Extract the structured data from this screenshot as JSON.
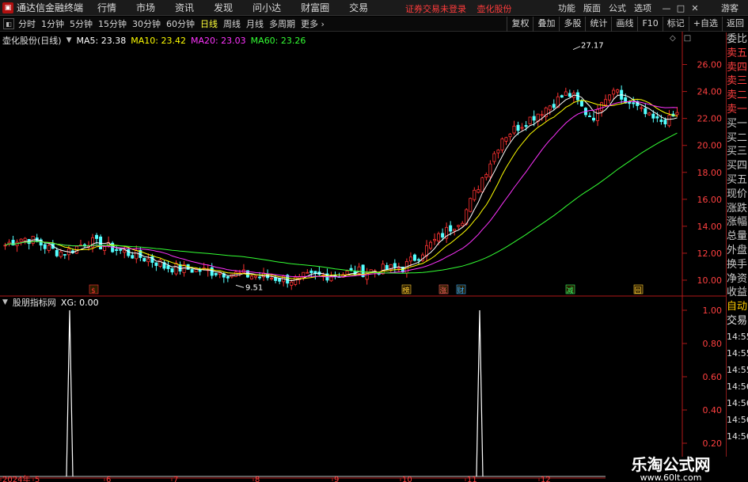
{
  "app": {
    "title": "通达信金融终端",
    "icon": "app-logo-icon"
  },
  "menu": [
    "行情",
    "市场",
    "资讯",
    "发现",
    "问小达",
    "财富圈",
    "交易"
  ],
  "notice": {
    "left": "证券交易未登录",
    "right": "壶化股份"
  },
  "menu_right": [
    "功能",
    "版面",
    "公式",
    "选项"
  ],
  "guest": "游客",
  "periods": [
    {
      "label": "分时",
      "active": false
    },
    {
      "label": "1分钟",
      "active": false
    },
    {
      "label": "5分钟",
      "active": false
    },
    {
      "label": "15分钟",
      "active": false
    },
    {
      "label": "30分钟",
      "active": false
    },
    {
      "label": "60分钟",
      "active": false
    },
    {
      "label": "日线",
      "active": true
    },
    {
      "label": "周线",
      "active": false
    },
    {
      "label": "月线",
      "active": false
    },
    {
      "label": "多周期",
      "active": false
    },
    {
      "label": "更多",
      "active": false
    }
  ],
  "toolbar_right": [
    "复权",
    "叠加",
    "多股",
    "统计",
    "画线",
    "F10",
    "标记",
    "+自选",
    "返回"
  ],
  "stock": {
    "name": "壶化股份(日线)",
    "ma5": "MA5: 23.38",
    "ma10": "MA10: 23.42",
    "ma20": "MA20: 23.03",
    "ma60": "MA60: 23.26"
  },
  "indicator": {
    "name": "股朋指标网",
    "value": "XG: 0.00"
  },
  "colors": {
    "up": "#ff3232",
    "down": "#54ffff",
    "ma5": "#ffffff",
    "ma10": "#ffff00",
    "ma20": "#ff33ff",
    "ma60": "#33ff33",
    "axis": "#b01818"
  },
  "price_axis": [
    "26.00",
    "24.00",
    "22.00",
    "20.00",
    "18.00",
    "16.00",
    "14.00",
    "12.00",
    "10.00"
  ],
  "price_labels": {
    "high": "27.17",
    "low": "9.51"
  },
  "ind_axis": [
    "1.00",
    "0.80",
    "0.60",
    "0.40",
    "0.20"
  ],
  "date_axis": [
    "2024年",
    "5",
    "6",
    "7",
    "8",
    "9",
    "10",
    "11",
    "12"
  ],
  "event_markers": [
    {
      "label": "$",
      "color": "#ff3232"
    },
    {
      "label": "榜",
      "color": "#ffcc33"
    },
    {
      "label": "涨",
      "color": "#ff6060"
    },
    {
      "label": "财",
      "color": "#33aaff"
    },
    {
      "label": "减",
      "color": "#33ff66"
    },
    {
      "label": "回",
      "color": "#ffcc33"
    }
  ],
  "side_panel": {
    "items": [
      "委比",
      "卖五",
      "卖四",
      "卖三",
      "卖二",
      "卖一",
      "买一",
      "买二",
      "买三",
      "买四",
      "买五",
      "现价",
      "涨跌",
      "涨幅",
      "总量",
      "外盘",
      "换手",
      "净资",
      "收益"
    ],
    "auto": "自动",
    "deal": "交易",
    "times": [
      "14:55",
      "14:55",
      "14:55",
      "14:56",
      "14:56",
      "14:56",
      "14:56"
    ]
  },
  "watermark": {
    "title": "乐淘公式网",
    "url": "www.60lt.com"
  },
  "chart_data": {
    "type": "candlestick",
    "title": "壶化股份(日线)",
    "ylim": [
      9.0,
      27.5
    ],
    "x_months": [
      "5",
      "6",
      "7",
      "8",
      "9",
      "10",
      "11",
      "12"
    ],
    "high": 27.17,
    "low": 9.51,
    "ma_last": {
      "MA5": 23.38,
      "MA10": 23.42,
      "MA20": 23.03,
      "MA60": 23.26
    },
    "indicator": {
      "name": "XG",
      "current": 0.0,
      "spikes": 2,
      "ylim": [
        0,
        1.0
      ]
    }
  }
}
